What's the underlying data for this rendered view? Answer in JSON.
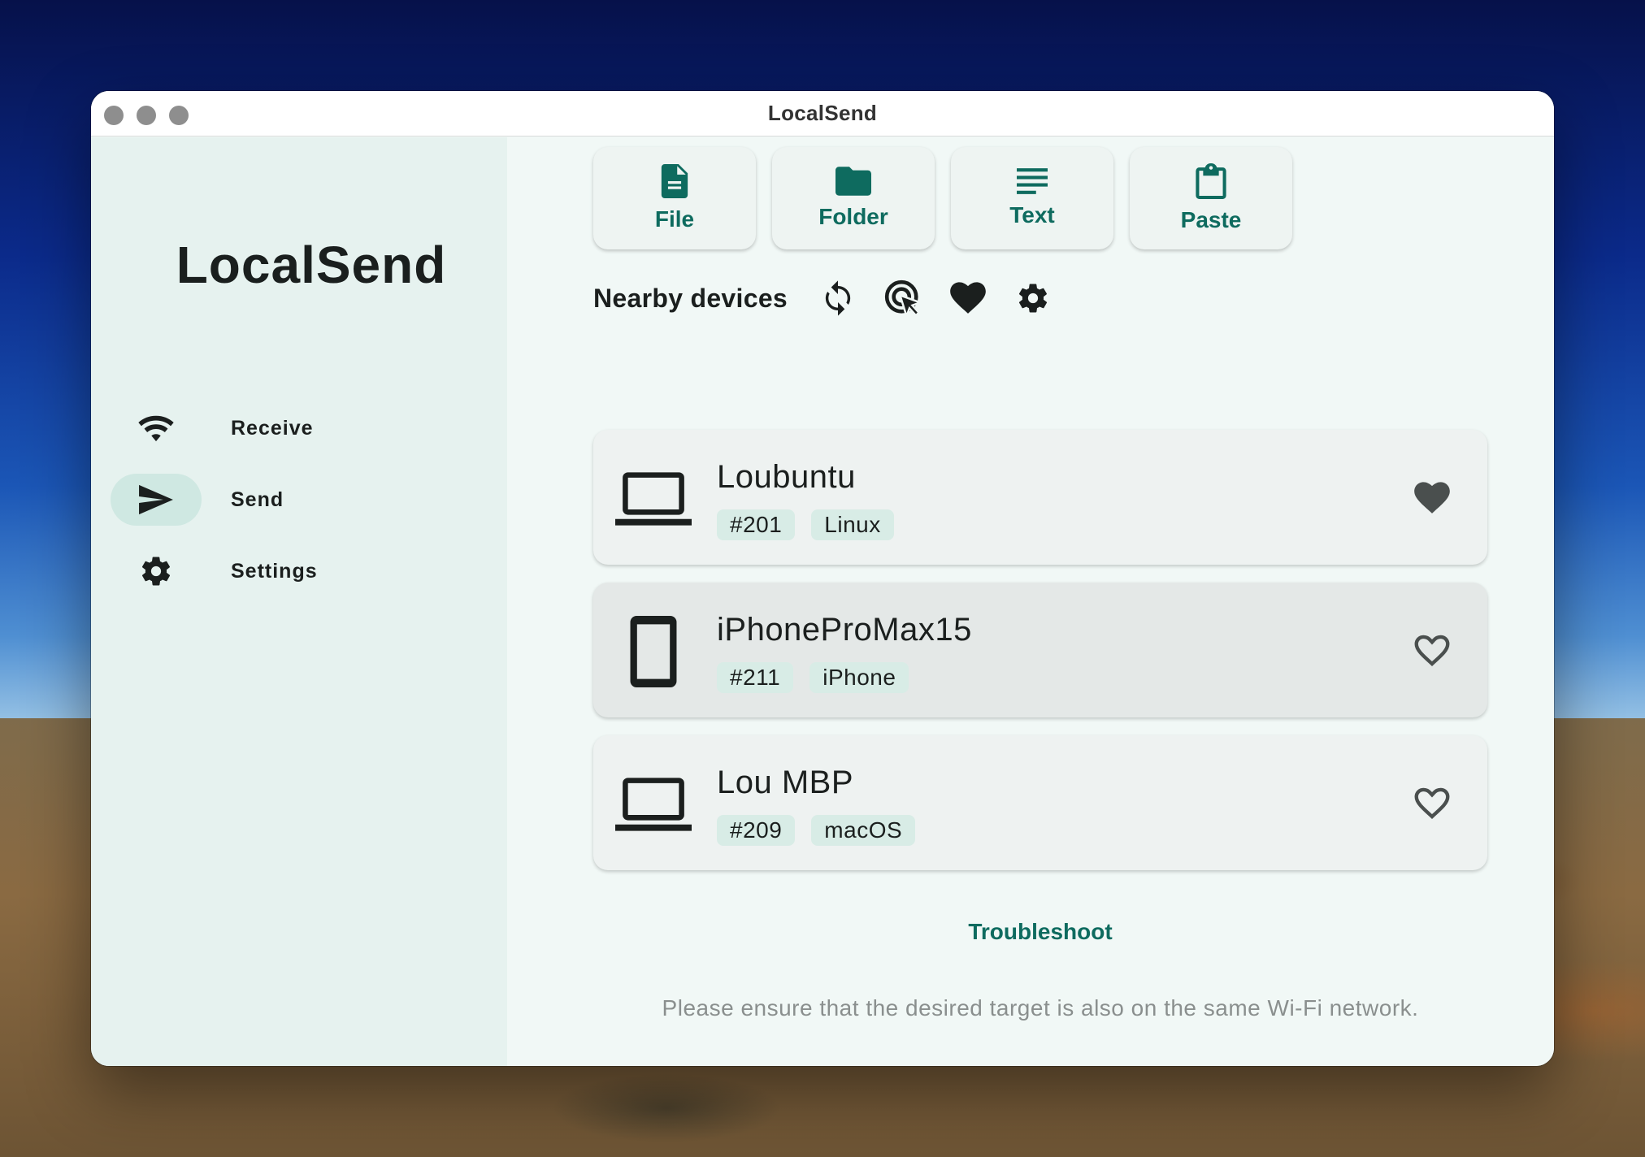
{
  "window": {
    "title": "LocalSend"
  },
  "sidebar": {
    "brand": "LocalSend",
    "items": [
      {
        "label": "Receive",
        "icon": "wifi-icon",
        "active": false
      },
      {
        "label": "Send",
        "icon": "send-icon",
        "active": true
      },
      {
        "label": "Settings",
        "icon": "gear-icon",
        "active": false
      }
    ]
  },
  "actions": [
    {
      "label": "File",
      "icon": "file-icon"
    },
    {
      "label": "Folder",
      "icon": "folder-icon"
    },
    {
      "label": "Text",
      "icon": "text-icon"
    },
    {
      "label": "Paste",
      "icon": "clipboard-icon"
    }
  ],
  "nearby": {
    "title": "Nearby devices",
    "tools": [
      "refresh-icon",
      "target-cursor-icon",
      "heart-icon",
      "gear-icon"
    ]
  },
  "devices": [
    {
      "name": "Loubuntu",
      "id_tag": "#201",
      "os_tag": "Linux",
      "type": "laptop-icon",
      "favorite": true
    },
    {
      "name": "iPhoneProMax15",
      "id_tag": "#211",
      "os_tag": "iPhone",
      "type": "phone-icon",
      "favorite": false
    },
    {
      "name": "Lou MBP",
      "id_tag": "#209",
      "os_tag": "macOS",
      "type": "laptop-icon",
      "favorite": false
    }
  ],
  "troubleshoot_label": "Troubleshoot",
  "hint": "Please ensure that the desired target is also on the same Wi-Fi network.",
  "colors": {
    "accent": "#0e6b5f",
    "sidebar_bg": "#e6f2ef",
    "main_bg": "#f1f8f6"
  }
}
